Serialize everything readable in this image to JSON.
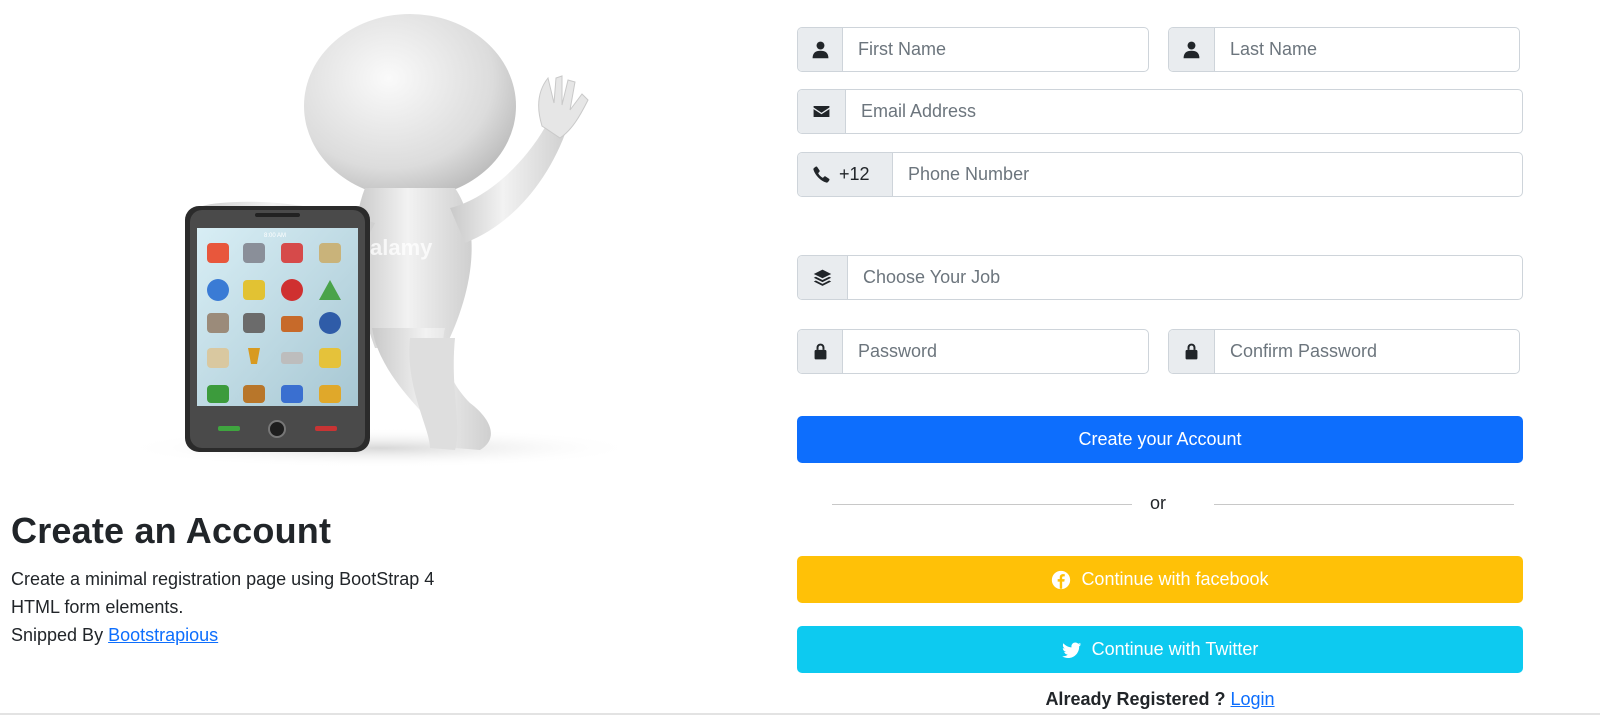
{
  "left": {
    "watermark": "alamy",
    "phone_time": "8:00 AM",
    "heading": "Create an Account",
    "description_line1": "Create a minimal registration page using BootStrap 4",
    "description_line2": "HTML form elements.",
    "snipped_by": "Snipped By",
    "snipped_link": "Bootstrapious"
  },
  "form": {
    "first_name": {
      "placeholder": "First Name",
      "value": "",
      "icon": "user-icon"
    },
    "last_name": {
      "placeholder": "Last Name",
      "value": "",
      "icon": "user-icon"
    },
    "email": {
      "placeholder": "Email Address",
      "value": "",
      "icon": "envelope-icon"
    },
    "phone": {
      "placeholder": "Phone Number",
      "value": "",
      "icon": "phone-icon",
      "country_code": "+12"
    },
    "job": {
      "placeholder": "Choose Your Job",
      "value": "",
      "icon": "layers-icon"
    },
    "password": {
      "placeholder": "Password",
      "value": "",
      "icon": "lock-icon"
    },
    "confirm_password": {
      "placeholder": "Confirm Password",
      "value": "",
      "icon": "lock-icon"
    },
    "create_button": "Create your Account",
    "or_text": "or",
    "facebook_button": "Continue with facebook",
    "twitter_button": "Continue with Twitter",
    "already_text": "Already Registered ?",
    "login_link": "Login"
  },
  "colors": {
    "primary": "#0d6efd",
    "warning": "#ffc107",
    "info": "#0dcaf0",
    "addon_bg": "#e9ecef",
    "border": "#ced4da"
  }
}
